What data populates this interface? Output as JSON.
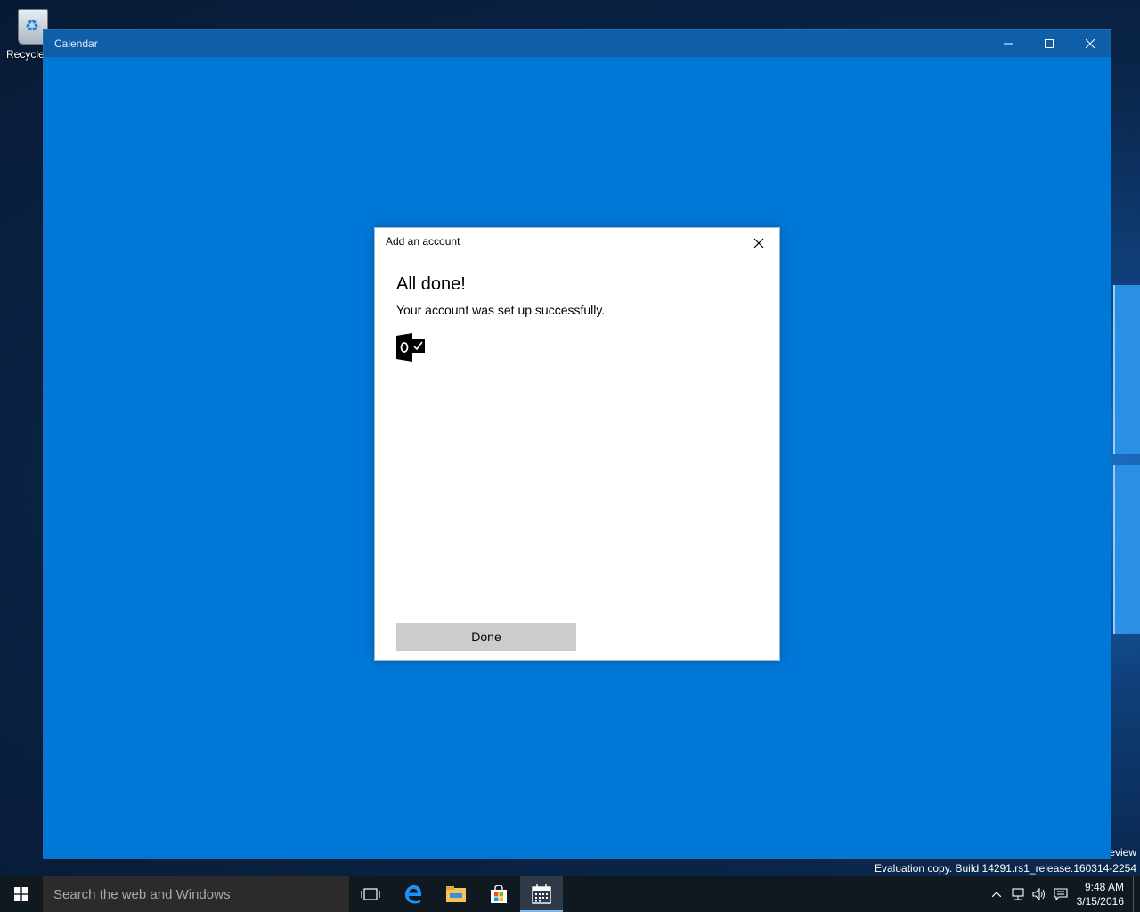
{
  "desktop": {
    "recycle_bin_label": "Recycle",
    "watermark_line1": "eview",
    "watermark_line2": "Evaluation copy. Build 14291.rs1_release.160314-2254"
  },
  "window": {
    "title": "Calendar"
  },
  "dialog": {
    "title": "Add an account",
    "heading": "All done!",
    "message": "Your account was set up successfully.",
    "account_icon": "outlook-icon",
    "done_label": "Done"
  },
  "taskbar": {
    "search_placeholder": "Search the web and Windows",
    "apps": [
      "task-view-icon",
      "edge-icon",
      "file-explorer-icon",
      "store-icon",
      "calendar-icon"
    ],
    "active_app": "calendar-icon",
    "clock_time": "9:48 AM",
    "clock_date": "3/15/2016"
  },
  "colors": {
    "app_background": "#0078d7",
    "titlebar": "#0f5ea8",
    "taskbar": "#101820",
    "done_button": "#cccccc"
  }
}
